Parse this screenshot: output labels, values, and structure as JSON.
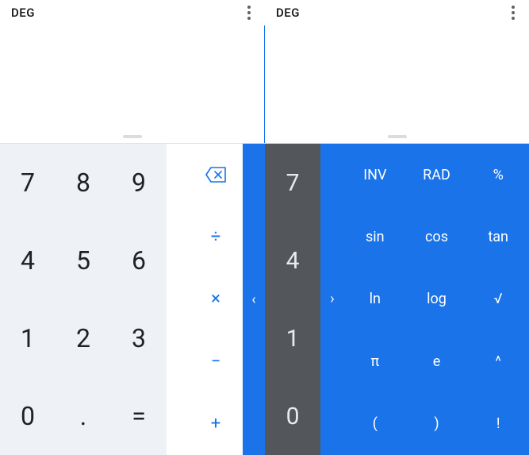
{
  "left": {
    "mode": "DEG",
    "digits": [
      [
        "7",
        "8",
        "9"
      ],
      [
        "4",
        "5",
        "6"
      ],
      [
        "1",
        "2",
        "3"
      ],
      [
        "0",
        ".",
        "="
      ]
    ],
    "ops": {
      "divide": "÷",
      "multiply": "×",
      "minus": "−",
      "plus": "+"
    },
    "expand": "‹"
  },
  "right": {
    "mode": "DEG",
    "digits": [
      "7",
      "4",
      "1",
      "0"
    ],
    "collapse": "›",
    "adv": [
      [
        "INV",
        "RAD",
        "%"
      ],
      [
        "sin",
        "cos",
        "tan"
      ],
      [
        "ln",
        "log",
        "√"
      ],
      [
        "π",
        "e",
        "^"
      ],
      [
        "(",
        ")",
        "!"
      ]
    ]
  }
}
